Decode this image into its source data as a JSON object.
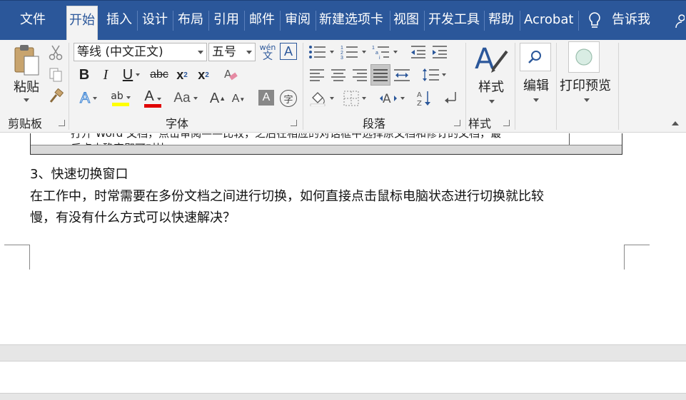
{
  "tabs": [
    "文件",
    "开始",
    "插入",
    "设计",
    "布局",
    "引用",
    "邮件",
    "审阅",
    "新建选项卡",
    "视图",
    "开发工具",
    "帮助",
    "Acrobat",
    "告诉我"
  ],
  "ribbon": {
    "clipboard": {
      "paste_label": "粘贴",
      "group_label": "剪贴板"
    },
    "font": {
      "font_name": "等线 (中文正文)",
      "font_size": "五号",
      "group_label": "字体",
      "phonetic_top": "wén",
      "phonetic_bottom": "文",
      "grow": "A",
      "shrink": "A",
      "case": "Aa",
      "char_shading": "A",
      "enclose": "字",
      "highlight_color": "#ffff00",
      "font_color": "#e00000"
    },
    "paragraph": {
      "group_label": "段落"
    },
    "styles": {
      "label": "样式",
      "group_label": "样式"
    },
    "editing": {
      "label": "编辑"
    },
    "print_preview": {
      "label": "打印预览"
    }
  },
  "document": {
    "table_partial_line1": "打开 Word 文档，点击审阅——比较，之后在相应的对话框中选择原文档和修订的文档，最",
    "table_partial_line2": "后点击确定即可对比。",
    "heading": "3、快速切换窗口",
    "body_line1": "在工作中，时常需要在多份文档之间进行切换，如何直接点击鼠标电脑状态进行切换就比较",
    "body_line2": "慢，有没有什么方式可以快速解决？"
  }
}
